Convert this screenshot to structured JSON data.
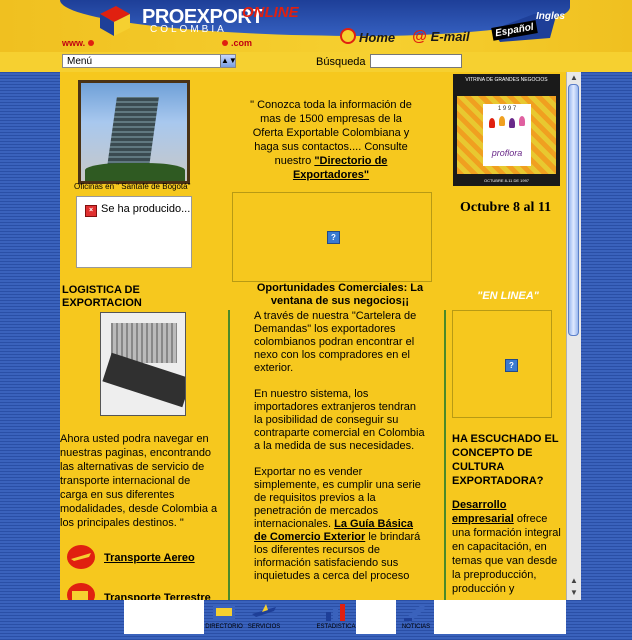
{
  "header": {
    "logo_main": "PROEXPORT",
    "logo_sub": "COLOMBIA",
    "logo_online": "ONLINE",
    "www": "www.",
    "com": ".com",
    "nav_home": "Home",
    "nav_email": "E-mail",
    "lang_ingles": "Ingles",
    "lang_espanol": "Español"
  },
  "toolbar": {
    "menu_value": "Menú",
    "busqueda_label": "Búsqueda",
    "busqueda_value": ""
  },
  "left": {
    "photo_caption": "Oficinas en \" Santafé de Bogotá\"",
    "error_text": "Se ha producido...",
    "logistica_title": "LOGISTICA DE EXPORTACION",
    "logistica_body": "Ahora usted podra navegar en nuestras paginas, encontrando las alternativas de servicio de transporte internacional de carga en sus diferentes modalidades, desde Colombia a los principales destinos. \"",
    "transport_aereo": "Transporte Aereo",
    "transport_terrestre": "Transporte Terrestre"
  },
  "center": {
    "intro_text": "\" Conozca toda la información de mas de 1500 empresas de la Oferta Exportable Colombiana y haga sus contactos.... Consulte nuestro",
    "intro_link": "\"Directorio de Exportadores\"",
    "op_title": "Oportunidades Comerciales: La ventana de sus negocios¡¡",
    "op_p1": "A través de nuestra \"Cartelera de Demandas\" los exportadores colombianos podran encontrar el nexo con los compradores en el exterior.",
    "op_p2": "En nuestro sistema, los importadores extranjeros tendran la posibilidad de conseguir su contraparte comercial en Colombia a la medida de sus necesidades.",
    "op_p3_start": "Exportar no es vender simplemente, es cumplir una serie de requisitos previos a la penetración de mercados internacionales.",
    "op_p3_link": "La Guía Básica de Comercio Exterior",
    "op_p3_end": "le brindará los diferentes recursos de información satisfaciendo sus inquietudes a cerca del proceso"
  },
  "right": {
    "ad_top": "VITRINA DE GRANDES NEGOCIOS",
    "ad_year": "1 9 9 7",
    "ad_brand": "proflora",
    "ad_bottom": "OCTUBRE 8-11 DE 1997",
    "octubre": "Octubre 8 al 11",
    "en_linea": "\"EN LINEA\"",
    "cultura_title": "HA ESCUCHADO EL CONCEPTO DE CULTURA EXPORTADORA?",
    "cultura_link": "Desarrollo empresarial",
    "cultura_body": "ofrece una formación integral en capacitación, en temas que van desde la preproducción, producción y"
  },
  "bottom": {
    "items": [
      {
        "label": "DIRECTORIO",
        "icon": "directory-icon"
      },
      {
        "label": "SERVICIOS",
        "icon": "airplane-icon"
      },
      {
        "label": "ESTADISTICA",
        "icon": "chart-icon"
      },
      {
        "label": "NOTICIAS",
        "icon": "news-icon"
      }
    ]
  },
  "colors": {
    "page_bg": "#2a4fa6",
    "content_bg": "#f6c81e",
    "accent_red": "#e02010",
    "line_green": "#4a8a2a"
  }
}
